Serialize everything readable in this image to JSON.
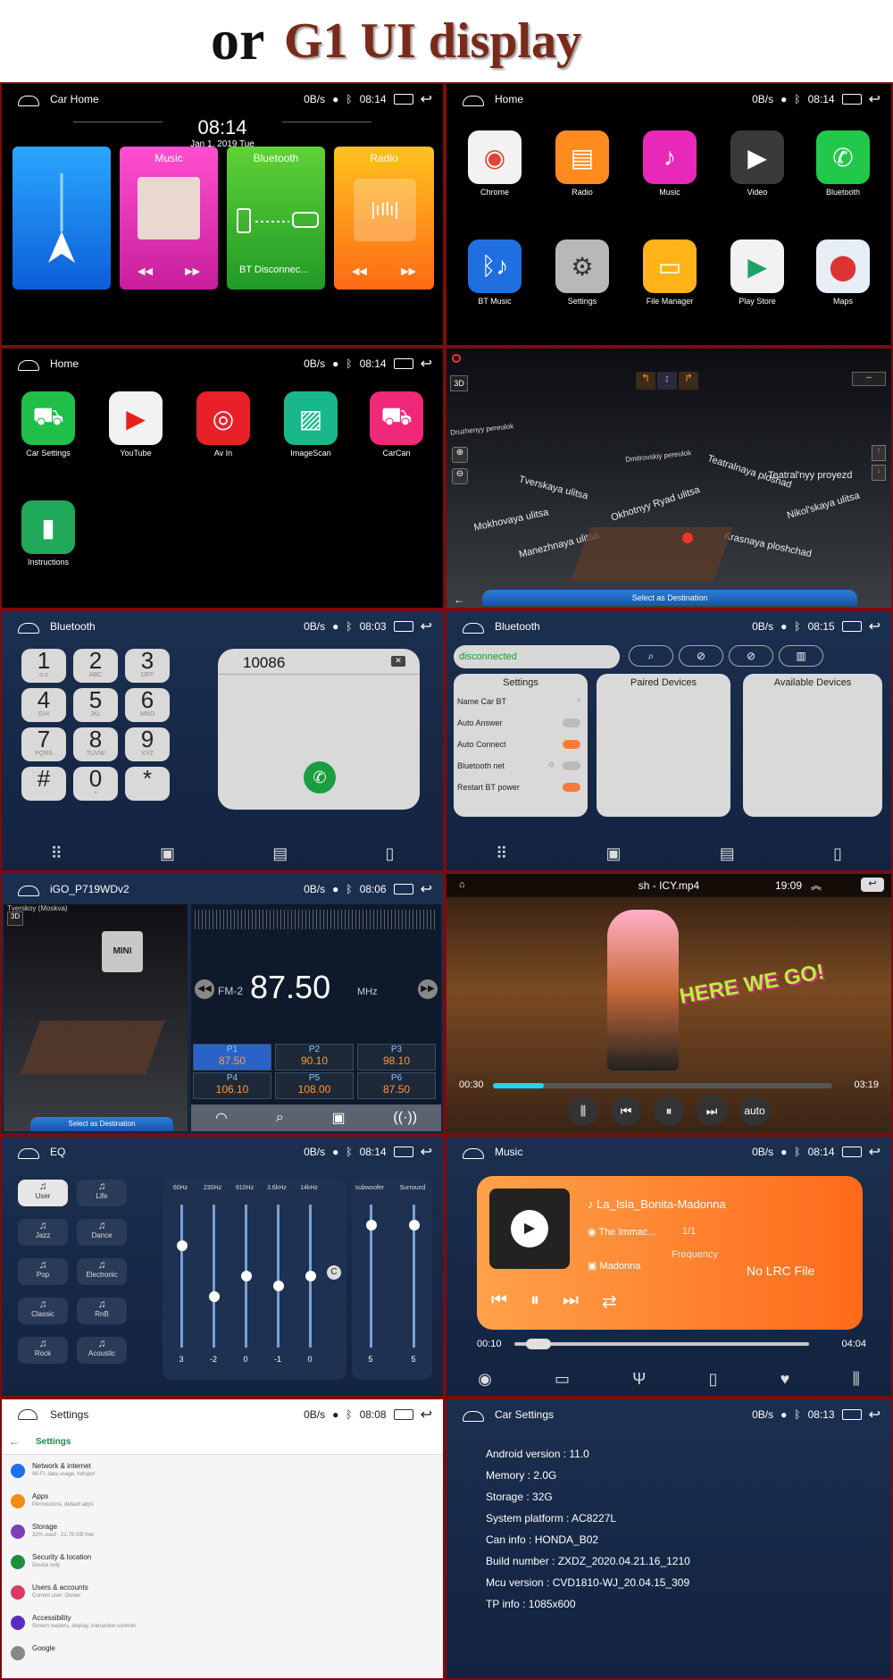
{
  "header": {
    "or": "or",
    "title": "G1 UI display"
  },
  "p1": {
    "title": "Car Home",
    "speed": "0B/s",
    "time": "08:14",
    "clock": "08:14",
    "date": "Jan 1, 2019  Tue",
    "tiles": {
      "music": "Music",
      "bluetooth": "Bluetooth",
      "radio": "Radio",
      "bt_status": "BT Disconnec..."
    }
  },
  "p2": {
    "title": "Home",
    "speed": "0B/s",
    "time": "08:14",
    "apps": [
      "Chrome",
      "Radio",
      "Music",
      "Video",
      "Bluetooth",
      "BT Music",
      "Settings",
      "File Manager",
      "Play Store",
      "Maps"
    ]
  },
  "p3": {
    "title": "Home",
    "speed": "0B/s",
    "time": "08:14",
    "apps": [
      "Car Settings",
      "YouTube",
      "Av In",
      "ImageScan",
      "CarCan",
      "Instructions"
    ]
  },
  "p4": {
    "btn3d": "3D",
    "more": "--",
    "select_dest": "Select as Destination",
    "streets": [
      "Druzhenyy pereulok",
      "Teatralnaya ploshad",
      "Okhotnyy Ryad ulitsa",
      "Tverskaya ulitsa",
      "Mokhovaya ulitsa",
      "Manezhnaya ulitsa",
      "Krasnaya ploshchad",
      "Nikol'skaya ulitsa",
      "Teatral'nyy proyezd",
      "Dmitrovskiy pereulok"
    ]
  },
  "p5": {
    "title": "Bluetooth",
    "speed": "0B/s",
    "time": "08:03",
    "number": "10086",
    "keys": [
      {
        "n": "1",
        "s": "o.o"
      },
      {
        "n": "2",
        "s": "ABC"
      },
      {
        "n": "3",
        "s": "DEF"
      },
      {
        "n": "4",
        "s": "GHI"
      },
      {
        "n": "5",
        "s": "JKL"
      },
      {
        "n": "6",
        "s": "MNO"
      },
      {
        "n": "7",
        "s": "PQRS"
      },
      {
        "n": "8",
        "s": "TUVW"
      },
      {
        "n": "9",
        "s": "XYZ"
      },
      {
        "n": "#",
        "s": ""
      },
      {
        "n": "0",
        "s": "+"
      },
      {
        "n": "*",
        "s": ""
      }
    ]
  },
  "p6": {
    "title": "Bluetooth",
    "speed": "0B/s",
    "time": "08:15",
    "status": "disconnected",
    "settings_title": "Settings",
    "paired": "Paired Devices",
    "available": "Available Devices",
    "rows": [
      "Name  Car BT",
      "Auto Answer",
      "Auto Connect",
      "Bluetooth net",
      "Restart BT power"
    ]
  },
  "p7": {
    "title": "iGO_P719WDv2",
    "speed": "0B/s",
    "time": "08:06",
    "band": "FM-2",
    "freq": "87.50",
    "unit": "MHz",
    "presets": [
      {
        "n": "P1",
        "f": "87.50"
      },
      {
        "n": "P2",
        "f": "90.10"
      },
      {
        "n": "P3",
        "f": "98.10"
      },
      {
        "n": "P4",
        "f": "106.10"
      },
      {
        "n": "P5",
        "f": "108.00"
      },
      {
        "n": "P6",
        "f": "87.50"
      }
    ],
    "select_dest": "Select as Destination",
    "street_top": "Tverskoy (Moskva)",
    "brand": "MINI"
  },
  "p8": {
    "file": "sh - ICY.mp4",
    "time": "19:09",
    "pos": "00:30",
    "dur": "03:19",
    "mode": "auto",
    "progress": 0.15,
    "overlay": "HERE WE GO!"
  },
  "p9": {
    "title": "EQ",
    "speed": "0B/s",
    "time": "08:14",
    "presets": [
      "User",
      "Life",
      "Jazz",
      "Dance",
      "Pop",
      "Electronic",
      "Classic",
      "RnB",
      "Rock",
      "Acoustic"
    ],
    "bands": [
      {
        "f": "60Hz",
        "v": "3"
      },
      {
        "f": "230Hz",
        "v": "-2"
      },
      {
        "f": "910Hz",
        "v": "0"
      },
      {
        "f": "3.6kHz",
        "v": "-1"
      },
      {
        "f": "14kHz",
        "v": "0"
      }
    ],
    "extra": [
      {
        "f": "subwoofer",
        "v": "5"
      },
      {
        "f": "Surround",
        "v": "5"
      }
    ]
  },
  "p10": {
    "title": "Music",
    "speed": "0B/s",
    "time": "08:14",
    "song": "La_Isla_Bonita-Madonna",
    "album": "The Immac...",
    "artist": "Madonna",
    "count": "1/1",
    "freq": "Frequency",
    "lrc": "No LRC File",
    "pos": "00:10",
    "dur": "04:04",
    "progress": 0.04
  },
  "p11": {
    "title": "Settings",
    "speed": "0B/s",
    "time": "08:08",
    "heading": "Settings",
    "rows": [
      {
        "t": "Network & internet",
        "s": "Wi-Fi, data usage, hotspot",
        "c": "#1a73e8"
      },
      {
        "t": "Apps",
        "s": "Permissions, default apps",
        "c": "#f28b1a"
      },
      {
        "t": "Storage",
        "s": "32% used - 21.78 GB free",
        "c": "#7b3fb8"
      },
      {
        "t": "Security & location",
        "s": "Device only",
        "c": "#1e8e3e"
      },
      {
        "t": "Users & accounts",
        "s": "Current user: Owner",
        "c": "#d93a6a"
      },
      {
        "t": "Accessibility",
        "s": "Screen readers, display, interaction controls",
        "c": "#5a2bbf"
      },
      {
        "t": "Google",
        "s": "",
        "c": "#888888"
      }
    ]
  },
  "p12": {
    "title": "Car Settings",
    "speed": "0B/s",
    "time": "08:13",
    "lines": [
      "Android version : 11.0",
      "Memory : 2.0G",
      "Storage : 32G",
      "System platform : AC8227L",
      "Can info : HONDA_B02",
      "Build number : ZXDZ_2020.04.21.16_1210",
      "Mcu version : CVD1810-WJ_20.04.15_309",
      "TP info : 1085x600"
    ]
  }
}
